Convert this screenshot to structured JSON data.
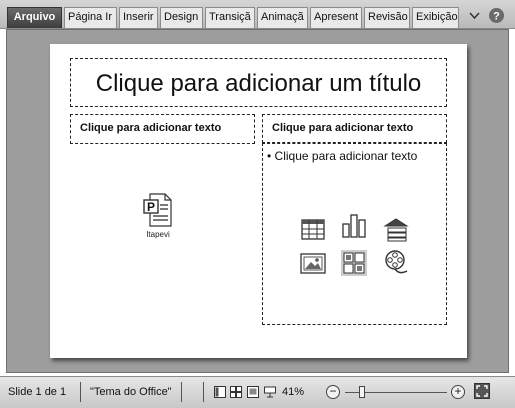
{
  "ribbon": {
    "tabs": [
      {
        "label": "Arquivo"
      },
      {
        "label": "Página Ir"
      },
      {
        "label": "Inserir"
      },
      {
        "label": "Design"
      },
      {
        "label": "Transiçã"
      },
      {
        "label": "Animaçã"
      },
      {
        "label": "Apresent"
      },
      {
        "label": "Revisão"
      },
      {
        "label": "Exibição"
      }
    ],
    "minimize_icon": "chevron-down-icon",
    "help_icon": "help-icon",
    "file_tab_color": "#4a4a4a"
  },
  "slide": {
    "title_placeholder": "Clique para adicionar um título",
    "left_placeholder": "Clique para adicionar texto",
    "right_placeholder": "Clique para adicionar texto",
    "right_bullet": "• Clique para adicionar texto",
    "embedded_object": {
      "icon": "powerpoint-file-icon",
      "label": "Itapevi"
    },
    "content_icons": [
      "insert-table-icon",
      "insert-chart-icon",
      "insert-smartart-icon",
      "insert-picture-icon",
      "insert-clipart-icon",
      "insert-media-icon"
    ]
  },
  "status_bar": {
    "slide_info": "Slide 1 de 1",
    "theme": "\"Tema do Office\"",
    "zoom_level": "41%",
    "zoom_fraction": 0.41,
    "view_icons": [
      "normal-view-icon",
      "slide-sorter-icon",
      "reading-view-icon",
      "slideshow-icon"
    ]
  }
}
